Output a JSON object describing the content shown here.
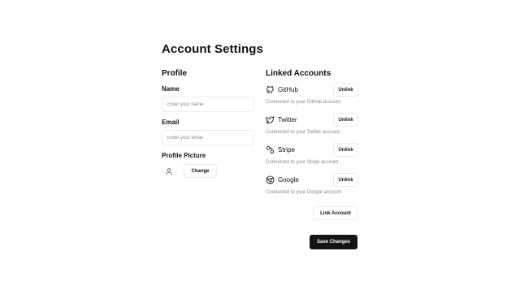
{
  "page": {
    "title": "Account Settings"
  },
  "profile": {
    "heading": "Profile",
    "name_label": "Name",
    "name_placeholder": "Enter your name",
    "name_value": "",
    "email_label": "Email",
    "email_placeholder": "Enter your email",
    "email_value": "",
    "picture_label": "Profile Picture",
    "avatar_icon": "user-icon",
    "change_label": "Change"
  },
  "linked": {
    "heading": "Linked Accounts",
    "accounts": [
      {
        "name": "GitHub",
        "icon": "github-icon",
        "description": "Connected to your GitHub account.",
        "action": "Unlink"
      },
      {
        "name": "Twitter",
        "icon": "twitter-icon",
        "description": "Connected to your Twitter account.",
        "action": "Unlink"
      },
      {
        "name": "Stripe",
        "icon": "stripe-icon",
        "description": "Connected to your Stripe account.",
        "action": "Unlink"
      },
      {
        "name": "Google",
        "icon": "chrome-icon",
        "description": "Connected to your Google account.",
        "action": "Unlink"
      }
    ],
    "link_label": "Link Account"
  },
  "actions": {
    "save_label": "Save Changes"
  },
  "colors": {
    "primary_button": "#151515",
    "muted_text": "#8a8a8a",
    "border": "#ececec"
  }
}
